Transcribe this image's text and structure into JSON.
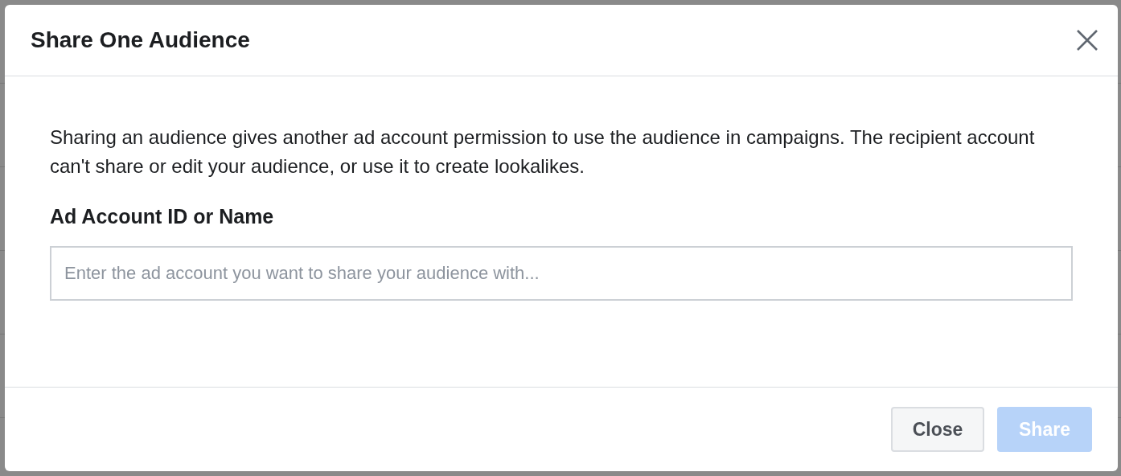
{
  "dialog": {
    "title": "Share One Audience",
    "description": "Sharing an audience gives another ad account permission to use the audience in campaigns. The recipient account can't share or edit your audience, or use it to create lookalikes.",
    "field": {
      "label": "Ad Account ID or Name",
      "placeholder": "Enter the ad account you want to share your audience with..."
    },
    "buttons": [
      {
        "label": "Close",
        "kind": "secondary",
        "disabled": false
      },
      {
        "label": "Share",
        "kind": "primary",
        "disabled": true
      }
    ]
  }
}
